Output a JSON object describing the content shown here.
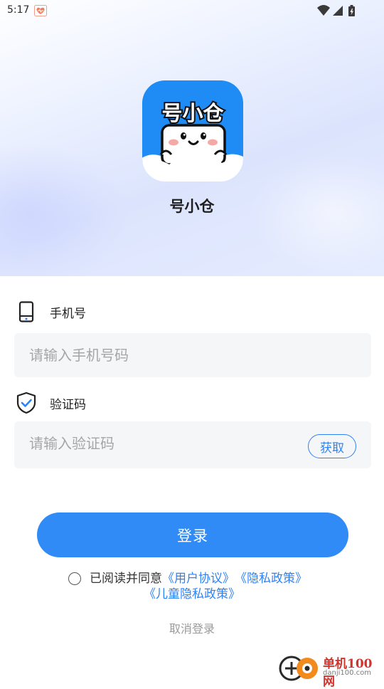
{
  "status_bar": {
    "time": "5:17",
    "app_icon": "heart-badge-icon",
    "right_icons": [
      "wifi-icon",
      "signal-icon",
      "battery-icon"
    ]
  },
  "app": {
    "name": "号小仓",
    "logo_text": "号小仓"
  },
  "phone_field": {
    "icon": "phone-icon",
    "label": "手机号",
    "placeholder": "请输入手机号码",
    "value": ""
  },
  "code_field": {
    "icon": "shield-check-icon",
    "label": "验证码",
    "placeholder": "请输入验证码",
    "value": "",
    "get_code_label": "获取"
  },
  "login_button_label": "登录",
  "agreement": {
    "checked": false,
    "prefix": "已阅读并同意",
    "user_agreement": "《用户协议》",
    "privacy_policy": "《隐私政策》",
    "children_privacy_policy": "《儿童隐私政策》"
  },
  "cancel_login_label": "取消登录",
  "watermark": {
    "title": "单机100网",
    "url": "danji100.com"
  },
  "colors": {
    "accent": "#318bf7",
    "link": "#2f82f6",
    "input_bg": "#f5f6f8",
    "logo_blue": "#1f8cf5"
  }
}
